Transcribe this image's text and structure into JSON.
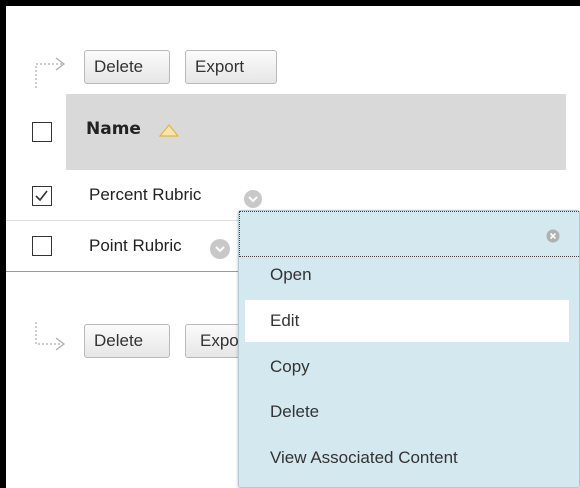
{
  "toolbar_top": {
    "delete_label": "Delete",
    "export_label": "Export"
  },
  "toolbar_bottom": {
    "delete_label": "Delete",
    "export_label": "Expo"
  },
  "table": {
    "header": {
      "name_label": "Name",
      "sort": "ascending"
    },
    "rows": [
      {
        "name": "Percent Rubric",
        "checked": true
      },
      {
        "name": "Point Rubric",
        "checked": false
      }
    ]
  },
  "context_menu": {
    "items": [
      {
        "label": "Open"
      },
      {
        "label": "Edit",
        "highlighted": true
      },
      {
        "label": "Copy"
      },
      {
        "label": "Delete"
      },
      {
        "label": "View Associated Content"
      }
    ]
  },
  "colors": {
    "header_bg": "#d9d9d9",
    "menu_bg": "#d4e8ef",
    "menu_highlight": "#ffffff",
    "sort_icon": "#f0c84a"
  }
}
